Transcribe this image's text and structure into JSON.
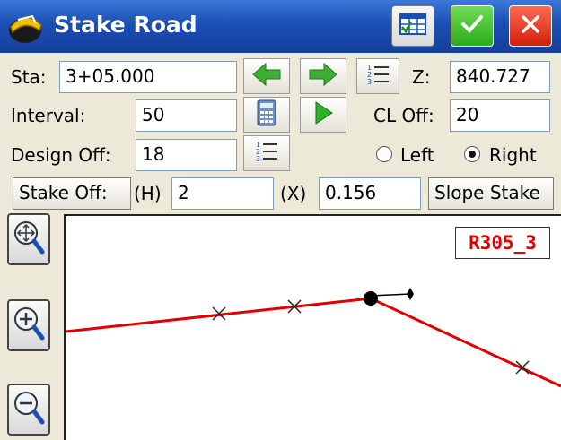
{
  "window": {
    "title": "Stake Road"
  },
  "form": {
    "sta_label": "Sta:",
    "sta_value": "3+05.000",
    "z_label": "Z:",
    "z_value": "840.727",
    "interval_label": "Interval:",
    "interval_value": "50",
    "cl_off_label": "CL Off:",
    "cl_off_value": "20",
    "design_off_label": "Design Off:",
    "design_off_value": "18",
    "side_left_label": "Left",
    "side_right_label": "Right",
    "side_selected": "Right",
    "stake_off_label": "Stake Off:",
    "h_label": "(H)",
    "h_value": "2",
    "x_label": "(X)",
    "x_value": "0.156",
    "slope_stake_label": "Slope Stake"
  },
  "map": {
    "alignment_name": "R305_3"
  },
  "colors": {
    "titlebar": "#1b4fb3",
    "alignment_line": "#e00000",
    "alignment_label": "#e00000",
    "ok_button": "#2bab1b",
    "close_button": "#d3200e"
  },
  "icons": {
    "app": "helmet-icon",
    "grid": "grid-icon",
    "ok": "checkmark-icon",
    "close": "close-icon",
    "prev": "arrow-left-icon",
    "next": "arrow-right-icon",
    "list": "list-icon",
    "calculator": "calculator-icon",
    "play": "play-icon",
    "zoom_extents": "zoom-extents-icon",
    "zoom_in": "zoom-in-icon",
    "zoom_out": "zoom-out-icon"
  }
}
